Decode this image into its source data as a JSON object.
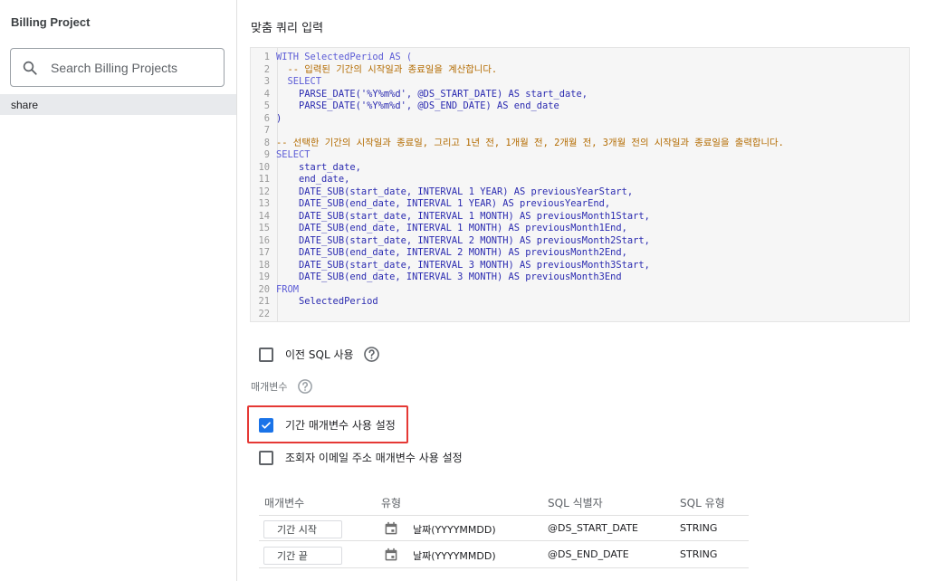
{
  "sidebar": {
    "title": "Billing Project",
    "search_placeholder": "Search Billing Projects",
    "items": [
      {
        "label": "share"
      }
    ]
  },
  "main": {
    "section_title": "맞춤 쿼리 입력",
    "code_lines": [
      "WITH SelectedPeriod AS (",
      "  -- 입력된 기간의 시작일과 종료일을 계산합니다.",
      "  SELECT",
      "    PARSE_DATE('%Y%m%d', @DS_START_DATE) AS start_date,",
      "    PARSE_DATE('%Y%m%d', @DS_END_DATE) AS end_date",
      ")",
      "",
      "-- 선택한 기간의 시작일과 종료일, 그리고 1년 전, 1개월 전, 2개월 전, 3개월 전의 시작일과 종료일을 출력합니다.",
      "SELECT",
      "    start_date,",
      "    end_date,",
      "    DATE_SUB(start_date, INTERVAL 1 YEAR) AS previousYearStart,",
      "    DATE_SUB(end_date, INTERVAL 1 YEAR) AS previousYearEnd,",
      "    DATE_SUB(start_date, INTERVAL 1 MONTH) AS previousMonth1Start,",
      "    DATE_SUB(end_date, INTERVAL 1 MONTH) AS previousMonth1End,",
      "    DATE_SUB(start_date, INTERVAL 2 MONTH) AS previousMonth2Start,",
      "    DATE_SUB(end_date, INTERVAL 2 MONTH) AS previousMonth2End,",
      "    DATE_SUB(start_date, INTERVAL 3 MONTH) AS previousMonth3Start,",
      "    DATE_SUB(end_date, INTERVAL 3 MONTH) AS previousMonth3End",
      "FROM",
      "    SelectedPeriod",
      ""
    ],
    "legacy_sql": {
      "label": "이전 SQL 사용",
      "checked": false
    },
    "params_label": "매개변수",
    "date_params": {
      "label": "기간 매개변수 사용 설정",
      "checked": true
    },
    "email_params": {
      "label": "조회자 이메일 주소 매개변수 사용 설정",
      "checked": false
    },
    "table": {
      "headers": [
        "매개변수",
        "유형",
        "SQL 식별자",
        "SQL 유형"
      ],
      "rows": [
        {
          "param": "기간 시작",
          "type": "날짜(YYYYMMDD)",
          "identifier": "@DS_START_DATE",
          "sql_type": "STRING"
        },
        {
          "param": "기간 끝",
          "type": "날짜(YYYYMMDD)",
          "identifier": "@DS_END_DATE",
          "sql_type": "STRING"
        }
      ]
    }
  },
  "colors": {
    "accent": "#1a73e8",
    "highlight": "#e53935"
  }
}
